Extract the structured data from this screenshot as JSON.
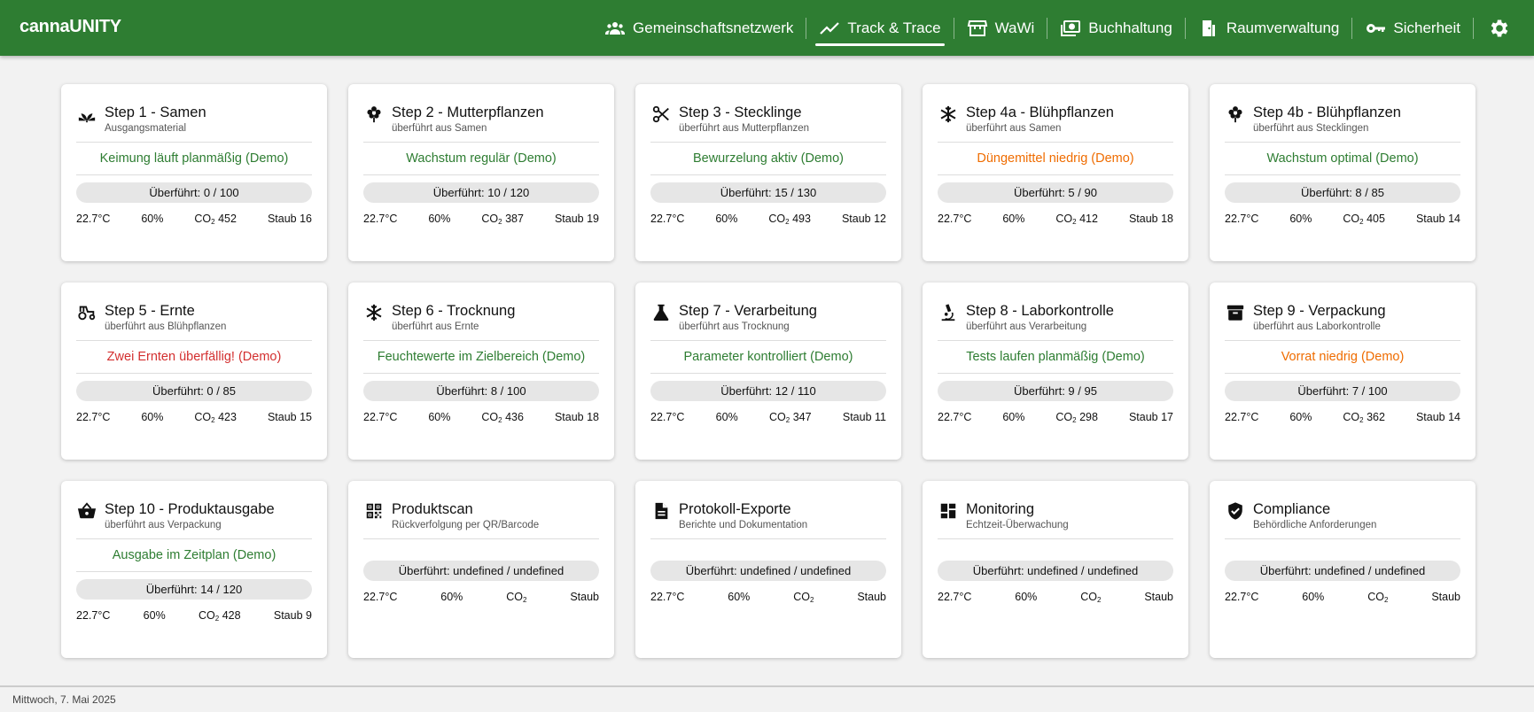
{
  "app": {
    "brand": "cannaUNITY"
  },
  "nav": [
    {
      "label": "Gemeinschaftsnetzwerk",
      "icon": "people-icon"
    },
    {
      "label": "Track & Trace",
      "icon": "trending-icon",
      "active": true
    },
    {
      "label": "WaWi",
      "icon": "store-icon"
    },
    {
      "label": "Buchhaltung",
      "icon": "money-icon"
    },
    {
      "label": "Raumverwaltung",
      "icon": "door-icon"
    },
    {
      "label": "Sicherheit",
      "icon": "key-icon"
    }
  ],
  "cards": [
    {
      "title": "Step 1 - Samen",
      "subtitle": "Ausgangsmaterial",
      "status": "Keimung läuft planmäßig (Demo)",
      "status_color": "#2e7d32",
      "progress": "Überführt: 0 / 100",
      "temp": "22.7°C",
      "humidity": "60%",
      "co2_label": "CO",
      "co2_value": "452",
      "dust": "Staub 16",
      "icon": "sprout-icon"
    },
    {
      "title": "Step 2 - Mutterpflanzen",
      "subtitle": "überführt aus Samen",
      "status": "Wachstum regulär (Demo)",
      "status_color": "#2e7d32",
      "progress": "Überführt: 10 / 120",
      "temp": "22.7°C",
      "humidity": "60%",
      "co2_label": "CO",
      "co2_value": "387",
      "dust": "Staub 19",
      "icon": "flower-icon"
    },
    {
      "title": "Step 3 - Stecklinge",
      "subtitle": "überführt aus Mutterpflanzen",
      "status": "Bewurzelung aktiv (Demo)",
      "status_color": "#2e7d32",
      "progress": "Überführt: 15 / 130",
      "temp": "22.7°C",
      "humidity": "60%",
      "co2_label": "CO",
      "co2_value": "493",
      "dust": "Staub 12",
      "icon": "scissors-icon"
    },
    {
      "title": "Step 4a - Blühpflanzen",
      "subtitle": "überführt aus Samen",
      "status": "Düngemittel niedrig (Demo)",
      "status_color": "#ef6c00",
      "progress": "Überführt: 5 / 90",
      "temp": "22.7°C",
      "humidity": "60%",
      "co2_label": "CO",
      "co2_value": "412",
      "dust": "Staub 18",
      "icon": "snowflake-icon"
    },
    {
      "title": "Step 4b - Blühpflanzen",
      "subtitle": "überführt aus Stecklingen",
      "status": "Wachstum optimal (Demo)",
      "status_color": "#2e7d32",
      "progress": "Überführt: 8 / 85",
      "temp": "22.7°C",
      "humidity": "60%",
      "co2_label": "CO",
      "co2_value": "405",
      "dust": "Staub 14",
      "icon": "flower-icon"
    },
    {
      "title": "Step 5 - Ernte",
      "subtitle": "überführt aus Blühpflanzen",
      "status": "Zwei Ernten überfällig! (Demo)",
      "status_color": "#d32f2f",
      "progress": "Überführt: 0 / 85",
      "temp": "22.7°C",
      "humidity": "60%",
      "co2_label": "CO",
      "co2_value": "423",
      "dust": "Staub 15",
      "icon": "tractor-icon"
    },
    {
      "title": "Step 6 - Trocknung",
      "subtitle": "überführt aus Ernte",
      "status": "Feuchtewerte im Zielbereich (Demo)",
      "status_color": "#2e7d32",
      "progress": "Überführt: 8 / 100",
      "temp": "22.7°C",
      "humidity": "60%",
      "co2_label": "CO",
      "co2_value": "436",
      "dust": "Staub 18",
      "icon": "snowflake-icon"
    },
    {
      "title": "Step 7 - Verarbeitung",
      "subtitle": "überführt aus Trocknung",
      "status": "Parameter kontrolliert (Demo)",
      "status_color": "#2e7d32",
      "progress": "Überführt: 12 / 110",
      "temp": "22.7°C",
      "humidity": "60%",
      "co2_label": "CO",
      "co2_value": "347",
      "dust": "Staub 11",
      "icon": "flask-icon"
    },
    {
      "title": "Step 8 - Laborkontrolle",
      "subtitle": "überführt aus Verarbeitung",
      "status": "Tests laufen planmäßig (Demo)",
      "status_color": "#2e7d32",
      "progress": "Überführt: 9 / 95",
      "temp": "22.7°C",
      "humidity": "60%",
      "co2_label": "CO",
      "co2_value": "298",
      "dust": "Staub 17",
      "icon": "microscope-icon"
    },
    {
      "title": "Step 9 - Verpackung",
      "subtitle": "überführt aus Laborkontrolle",
      "status": "Vorrat niedrig (Demo)",
      "status_color": "#ef6c00",
      "progress": "Überführt: 7 / 100",
      "temp": "22.7°C",
      "humidity": "60%",
      "co2_label": "CO",
      "co2_value": "362",
      "dust": "Staub 14",
      "icon": "archive-icon"
    },
    {
      "title": "Step 10 - Produktausgabe",
      "subtitle": "überführt aus Verpackung",
      "status": "Ausgabe im Zeitplan (Demo)",
      "status_color": "#2e7d32",
      "progress": "Überführt: 14 / 120",
      "temp": "22.7°C",
      "humidity": "60%",
      "co2_label": "CO",
      "co2_value": "428",
      "dust": "Staub 9",
      "icon": "basket-icon"
    },
    {
      "title": "Produktscan",
      "subtitle": "Rückverfolgung per QR/Barcode",
      "status": "",
      "progress": "Überführt: undefined / undefined",
      "temp": "22.7°C",
      "humidity": "60%",
      "co2_label": "CO",
      "co2_value": "",
      "dust": "Staub",
      "icon": "qr-icon",
      "tool": true
    },
    {
      "title": "Protokoll-Exporte",
      "subtitle": "Berichte und Dokumentation",
      "status": "",
      "progress": "Überführt: undefined / undefined",
      "temp": "22.7°C",
      "humidity": "60%",
      "co2_label": "CO",
      "co2_value": "",
      "dust": "Staub",
      "icon": "document-icon",
      "tool": true
    },
    {
      "title": "Monitoring",
      "subtitle": "Echtzeit-Überwachung",
      "status": "",
      "progress": "Überführt: undefined / undefined",
      "temp": "22.7°C",
      "humidity": "60%",
      "co2_label": "CO",
      "co2_value": "",
      "dust": "Staub",
      "icon": "dashboard-icon",
      "tool": true
    },
    {
      "title": "Compliance",
      "subtitle": "Behördliche Anforderungen",
      "status": "",
      "progress": "Überführt: undefined / undefined",
      "temp": "22.7°C",
      "humidity": "60%",
      "co2_label": "CO",
      "co2_value": "",
      "dust": "Staub",
      "icon": "shield-check-icon",
      "tool": true
    }
  ],
  "footer": {
    "date": "Mittwoch, 7. Mai 2025"
  },
  "colors": {
    "appbar": "#2e7d32",
    "status_green": "#2e7d32",
    "status_orange": "#ef6c00",
    "status_red": "#d32f2f"
  }
}
